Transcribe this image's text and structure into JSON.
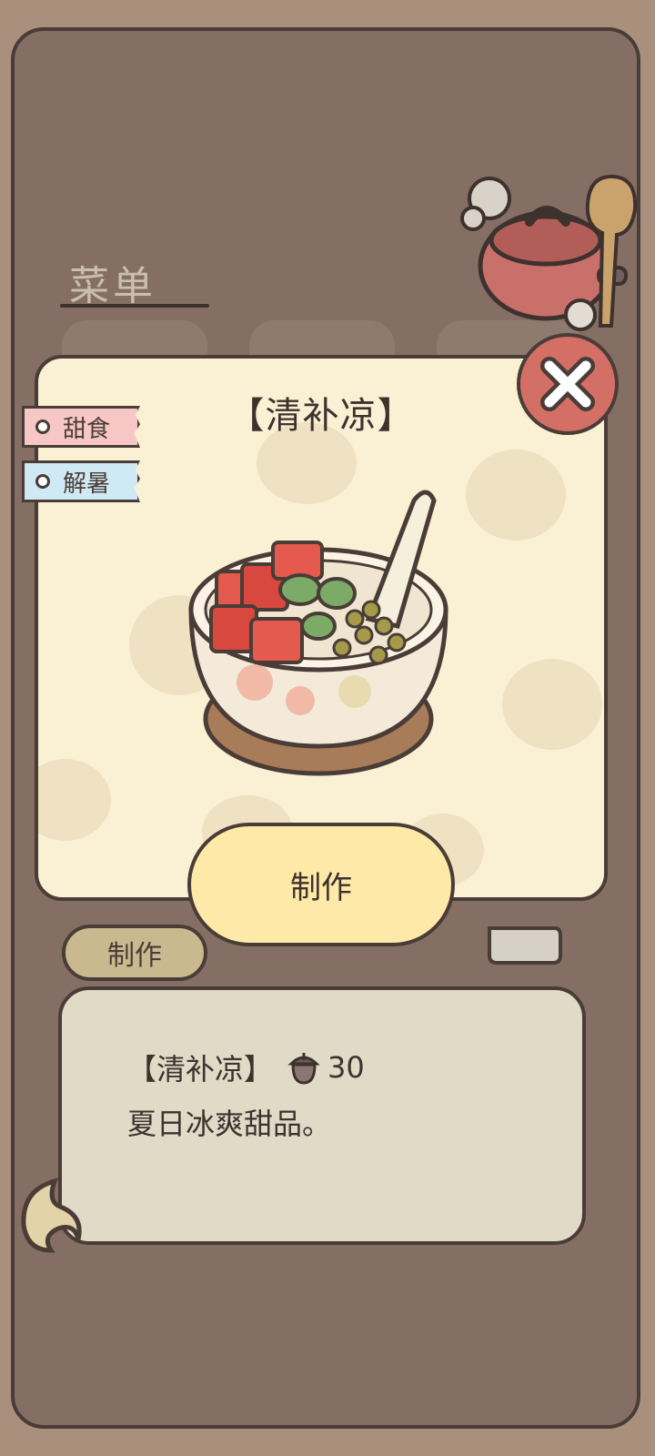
{
  "menu": {
    "title": "菜单"
  },
  "background": {
    "make_label": "制作"
  },
  "recipe": {
    "name": "【清补凉】",
    "tags": [
      {
        "label": "甜食",
        "color": "#f6c7c4"
      },
      {
        "label": "解暑",
        "color": "#cfe9f5"
      }
    ],
    "make_label": "制作"
  },
  "description": {
    "name": "【清补凉】",
    "price": "30",
    "currency_icon": "acorn-icon",
    "text": "夏日冰爽甜品。"
  },
  "colors": {
    "frame": "#856f64",
    "popup": "#faf1d4",
    "close": "#d46f66",
    "primary_button": "#ffe9a8",
    "outline": "#4a3c37"
  }
}
